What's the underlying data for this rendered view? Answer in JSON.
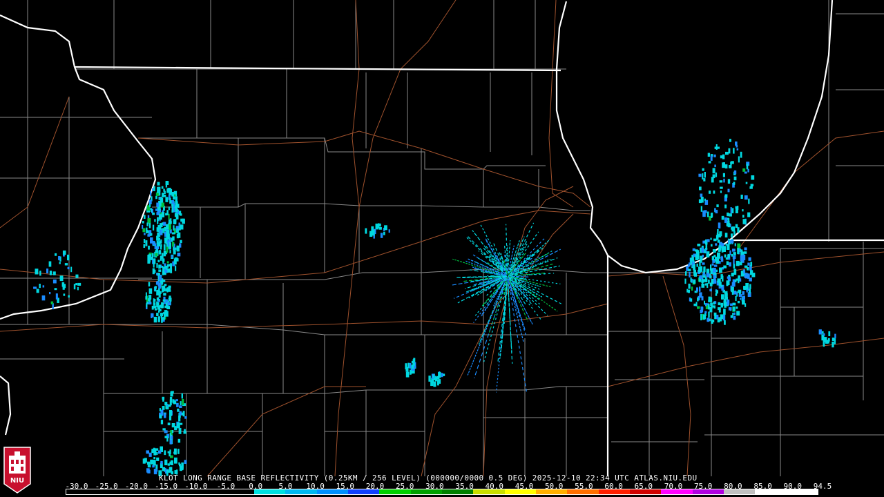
{
  "caption": "KLOT LONG RANGE BASE REFLECTIVITY (0.25KM / 256 LEVEL) (000000/0000 0.5 DEG) 2025-12-10 22:34 UTC  ATLAS.NIU.EDU",
  "logo_text": "NIU",
  "scale": {
    "labels": [
      "-30.0",
      "-25.0",
      "-20.0",
      "-15.0",
      "-10.0",
      "-5.0",
      "0.0",
      "5.0",
      "10.0",
      "15.0",
      "20.0",
      "25.0",
      "30.0",
      "35.0",
      "40.0",
      "45.0",
      "50.0",
      "55.0",
      "60.0",
      "65.0",
      "70.0",
      "75.0",
      "80.0",
      "85.0",
      "90.0",
      "94.5"
    ],
    "colors": [
      "#000000",
      "#000000",
      "#000000",
      "#000000",
      "#000000",
      "#000000",
      "#00e0e0",
      "#00b8f0",
      "#0090ff",
      "#1040ff",
      "#00d000",
      "#00a000",
      "#008000",
      "#c8e000",
      "#ffff00",
      "#ffb000",
      "#ff7000",
      "#ff2000",
      "#d00000",
      "#ff00ff",
      "#b000e0",
      "#c0c0c0",
      "#ffffff",
      "#ffffff"
    ]
  },
  "map_colors": {
    "state_border": "#ffffff",
    "county": "#8a8a8a",
    "highway": "#a0522d",
    "echo_light": "#00d8e0",
    "echo_mid": "#1a8cff",
    "echo_heavy": "#00c040"
  }
}
